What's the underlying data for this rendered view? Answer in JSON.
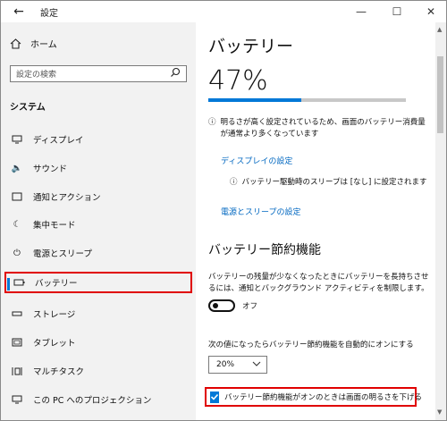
{
  "window": {
    "title": "設定"
  },
  "sidebar": {
    "home_label": "ホーム",
    "search_placeholder": "設定の検索",
    "section_label": "システム",
    "items": [
      {
        "label": "ディスプレイ",
        "icon": "display-icon"
      },
      {
        "label": "サウンド",
        "icon": "speaker-icon"
      },
      {
        "label": "通知とアクション",
        "icon": "notification-icon"
      },
      {
        "label": "集中モード",
        "icon": "moon-icon"
      },
      {
        "label": "電源とスリープ",
        "icon": "power-icon"
      },
      {
        "label": "バッテリー",
        "icon": "battery-icon",
        "selected": true
      },
      {
        "label": "ストレージ",
        "icon": "storage-icon"
      },
      {
        "label": "タブレット",
        "icon": "tablet-icon"
      },
      {
        "label": "マルチタスク",
        "icon": "multitask-icon"
      },
      {
        "label": "この PC へのプロジェクション",
        "icon": "projection-icon"
      }
    ]
  },
  "main": {
    "title": "バッテリー",
    "percent": "47%",
    "battery_level": 0.47,
    "brightness_warning": "明るさが高く設定されているため、画面のバッテリー消費量が通常より多くなっています",
    "display_link": "ディスプレイの設定",
    "sleep_info": "バッテリー駆動時のスリープは [なし] に設定されます",
    "power_link": "電源とスリープの設定",
    "saver_heading": "バッテリー節約機能",
    "saver_desc": "バッテリーの残量が少なくなったときにバッテリーを長持ちさせるには、通知とバックグラウンド アクティビティを制限します。",
    "toggle_state": "オフ",
    "auto_label": "次の値になったらバッテリー節約機能を自動的にオンにする",
    "auto_value": "20%",
    "brightness_checkbox_label": "バッテリー節約機能がオンのときは画面の明るさを下げる",
    "brightness_checkbox_checked": true
  },
  "colors": {
    "accent": "#0078d7",
    "highlight": "#e00000",
    "link": "#0067c0"
  }
}
